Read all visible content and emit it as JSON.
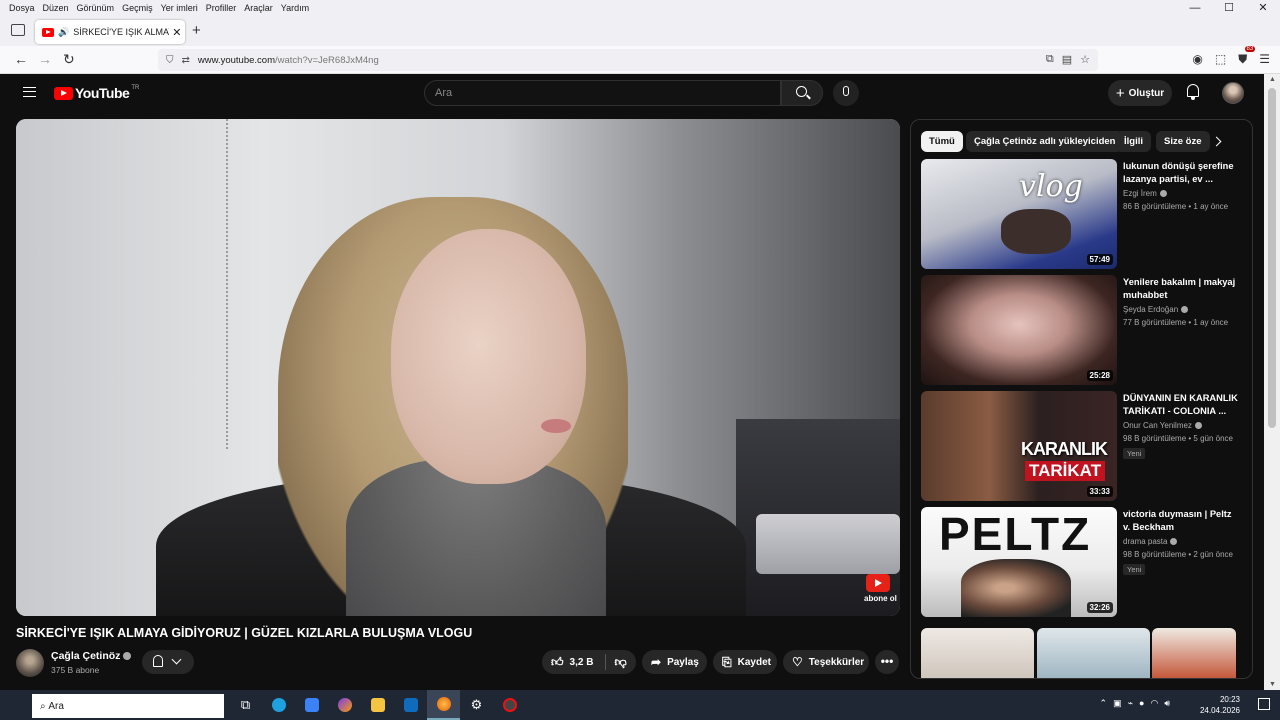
{
  "menubar": {
    "items": [
      "Dosya",
      "Düzen",
      "Görünüm",
      "Geçmiş",
      "Yer imleri",
      "Profiller",
      "Araçlar",
      "Yardım"
    ],
    "window_controls": [
      "—",
      "☐",
      "✕"
    ]
  },
  "tab": {
    "title": "SİRKECİ'YE IŞIK ALMAYA Gİ",
    "close": "✕",
    "new_tab": "+"
  },
  "navbar": {
    "back": "←",
    "forward": "→",
    "reload": "↻",
    "url_host": "www.youtube.com",
    "url_path": "/watch?v=JeR68JxM4ng",
    "extension_badge": "83"
  },
  "youtube": {
    "logo_text": "YouTube",
    "country": "TR",
    "search_placeholder": "Ara",
    "create_label": "Oluştur",
    "create_icon": "+"
  },
  "video": {
    "title": "SİRKECİ'YE IŞIK ALMAYA GİDİYORUZ | GÜZEL KIZLARLA BULUŞMA VLOGU",
    "subscribe_watermark": "abone ol",
    "channel": "Çağla Çetinöz",
    "subscribers": "375 B abone",
    "likes": "3,2 B",
    "share_label": "Paylaş",
    "save_label": "Kaydet",
    "thanks_label": "Teşekkürler",
    "more": "•••"
  },
  "chips": [
    "Tümü",
    "Çağla Çetinöz adlı yükleyiciden",
    "İlgili",
    "Size öze"
  ],
  "recommendations": [
    {
      "title": "lukunun dönüşü şerefine lazanya partisi, ev ...",
      "channel": "Ezgi İrem",
      "meta": "86 B görüntüleme • 1 ay önce",
      "duration": "57:49",
      "thumb_text": "vlog"
    },
    {
      "title": "Yenilere bakalım |  makyaj muhabbet",
      "channel": "Şeyda Erdoğan",
      "meta": "77 B görüntüleme • 1 ay önce",
      "duration": "25:28"
    },
    {
      "title": "DÜNYANIN EN KARANLIK TARİKATI - COLONIA ...",
      "channel": "Onur Can Yenilmez",
      "meta": "98 B görüntüleme • 5 gün önce",
      "duration": "33:33",
      "badge": "Yeni",
      "thumb_text_1": "KARANLIK",
      "thumb_text_2": "TARİKAT"
    },
    {
      "title": "victoria duymasın | Peltz v. Beckham",
      "channel": "drama pasta",
      "meta": "98 B görüntüleme • 2 gün önce",
      "duration": "32:26",
      "badge": "Yeni",
      "thumb_text": "PELTZ"
    }
  ],
  "taskbar": {
    "search_placeholder": "Ara",
    "time": "20:23",
    "date": "24.04.2026"
  }
}
